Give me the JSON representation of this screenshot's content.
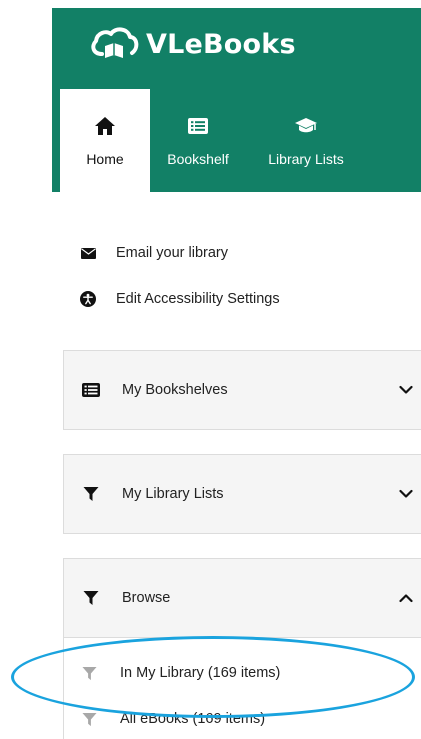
{
  "brand": {
    "name": "VLeBooks",
    "colors": {
      "header": "#128066",
      "annotation": "#1aa3de"
    }
  },
  "tabs": [
    {
      "label": "Home",
      "icon": "home-icon",
      "active": true
    },
    {
      "label": "Bookshelf",
      "icon": "list-icon",
      "active": false
    },
    {
      "label": "Library Lists",
      "icon": "graduation-cap-icon",
      "active": false
    }
  ],
  "quick_links": [
    {
      "label": "Email your library",
      "icon": "envelope-icon"
    },
    {
      "label": "Edit Accessibility Settings",
      "icon": "accessibility-icon"
    }
  ],
  "panels": {
    "bookshelves": {
      "label": "My Bookshelves",
      "icon": "list-icon",
      "state": "collapsed"
    },
    "library_lists": {
      "label": "My Library Lists",
      "icon": "filter-icon",
      "state": "collapsed"
    },
    "browse": {
      "label": "Browse",
      "icon": "filter-icon",
      "state": "expanded",
      "items": [
        {
          "label": "In My Library (169 items)",
          "icon": "filter-icon"
        },
        {
          "label": "All eBooks (169 items)",
          "icon": "filter-icon"
        }
      ]
    }
  }
}
